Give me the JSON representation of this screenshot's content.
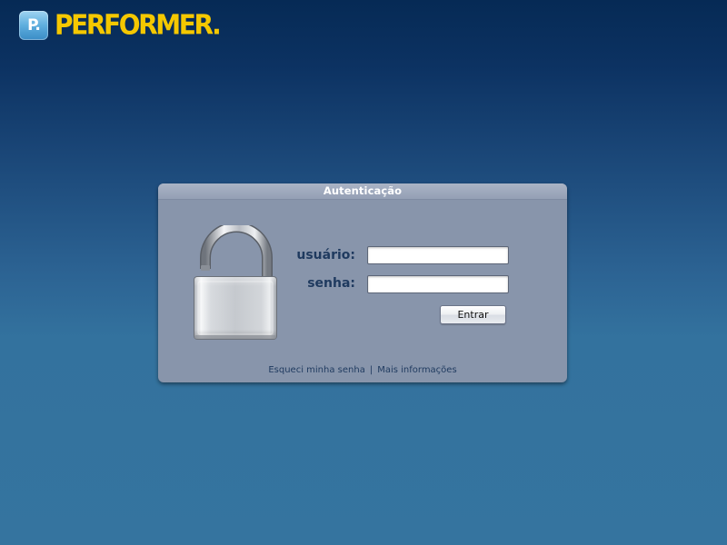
{
  "brand": {
    "badge_text": "P.",
    "name": "PERFORMER.",
    "accent_color": "#f5c800"
  },
  "login": {
    "title": "Autenticação",
    "username_label": "usuário:",
    "username_value": "",
    "password_label": "senha:",
    "password_value": "",
    "submit_label": "Entrar",
    "lock_icon": "padlock-open-icon"
  },
  "links": {
    "forgot_password": "Esqueci minha senha",
    "separator": "|",
    "more_info": "Mais informações"
  }
}
